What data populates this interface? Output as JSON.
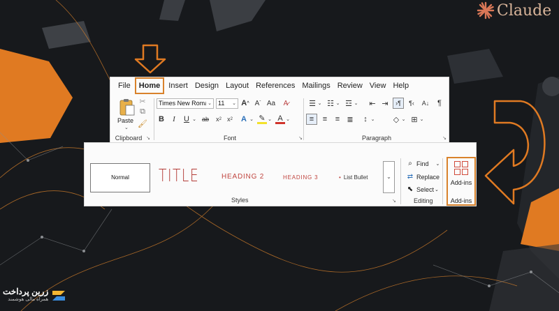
{
  "brand": {
    "name": "Claude",
    "accent": "#d97757"
  },
  "tabs": [
    "File",
    "Home",
    "Insert",
    "Design",
    "Layout",
    "References",
    "Mailings",
    "Review",
    "View",
    "Help"
  ],
  "active_tab": "Home",
  "clipboard": {
    "paste_label": "Paste",
    "group_label": "Clipboard"
  },
  "font": {
    "name": "Times New Roman",
    "size": "11",
    "group_label": "Font"
  },
  "paragraph": {
    "group_label": "Paragraph"
  },
  "styles": {
    "normal": "Normal",
    "title": "TITLE",
    "heading2": "HEADING 2",
    "heading3": "HEADING 3",
    "list_bullet": "List Bullet",
    "group_label": "Styles"
  },
  "editing": {
    "find": "Find",
    "replace": "Replace",
    "select": "Select",
    "group_label": "Editing"
  },
  "addins": {
    "button_label": "Add-ins",
    "group_label": "Add-ins"
  },
  "watermark": {
    "name": "زرین پرداخت",
    "tagline": "همراه مالی هوشمند"
  },
  "colors": {
    "highlight": "#d9822b",
    "heading": "#c0453f",
    "background": "#16181b"
  }
}
